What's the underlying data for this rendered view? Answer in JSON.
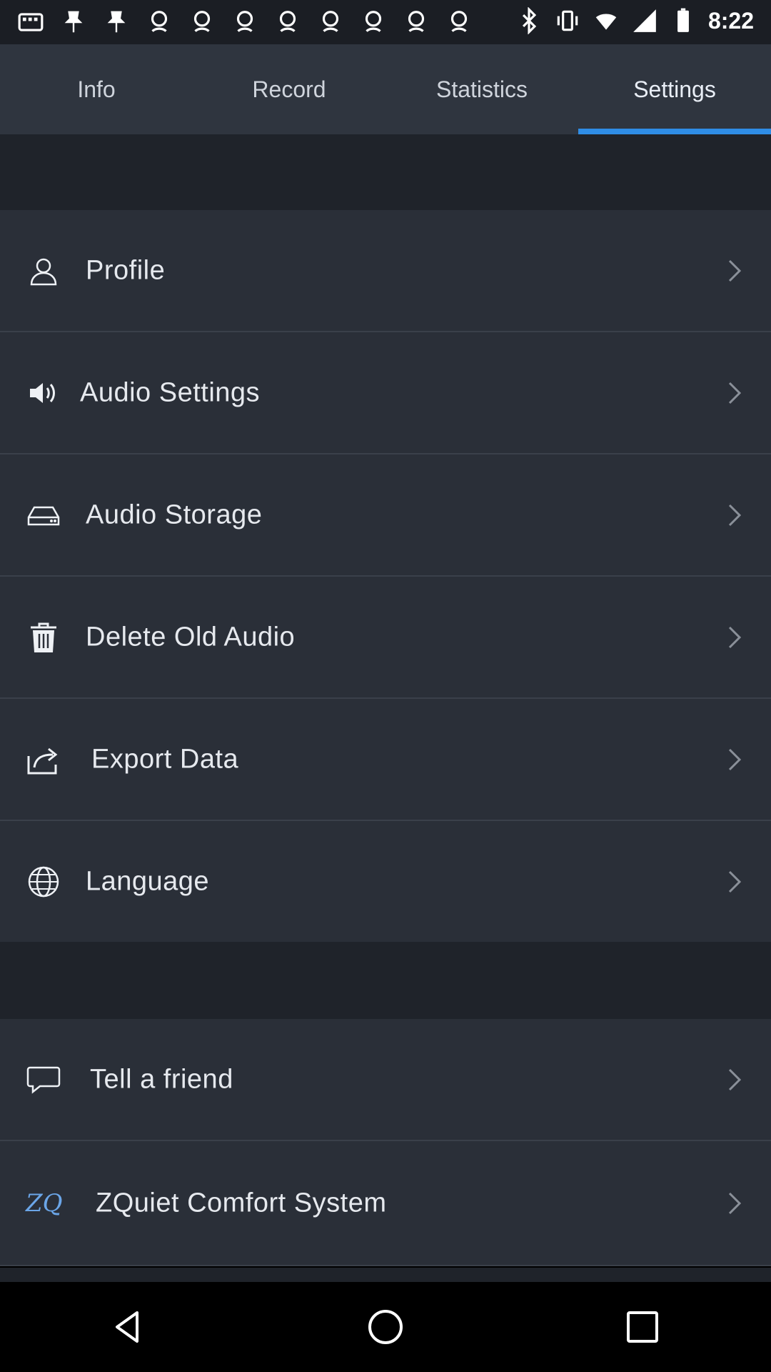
{
  "status_bar": {
    "time": "8:22",
    "notification_icons": [
      "app-icon",
      "app-icon",
      "app-icon",
      "app-icon",
      "app-icon",
      "app-icon",
      "app-icon",
      "app-icon",
      "app-icon",
      "app-icon",
      "app-icon"
    ],
    "right_icons": [
      "bluetooth-icon",
      "vibrate-icon",
      "wifi-icon",
      "signal-icon",
      "battery-icon"
    ]
  },
  "tabs": [
    {
      "label": "Info",
      "active": false
    },
    {
      "label": "Record",
      "active": false
    },
    {
      "label": "Statistics",
      "active": false
    },
    {
      "label": "Settings",
      "active": true
    }
  ],
  "settings": {
    "group1": [
      {
        "label": "Profile",
        "icon": "user-icon"
      },
      {
        "label": "Audio Settings",
        "icon": "speaker-icon"
      },
      {
        "label": "Audio Storage",
        "icon": "storage-icon"
      },
      {
        "label": "Delete Old Audio",
        "icon": "trash-icon"
      },
      {
        "label": "Export Data",
        "icon": "share-icon"
      },
      {
        "label": "Language",
        "icon": "globe-icon"
      }
    ],
    "group2": [
      {
        "label": "Tell a friend",
        "icon": "chat-icon"
      },
      {
        "label": "ZQuiet Comfort System",
        "icon": "zq-logo",
        "logo_text": "ZQ"
      }
    ]
  },
  "colors": {
    "accent": "#2f8de6",
    "tab_bar": "#2f353f",
    "row_bg": "#2a2f38",
    "section_gap": "#1f232a",
    "logo": "#6ba6e8"
  }
}
